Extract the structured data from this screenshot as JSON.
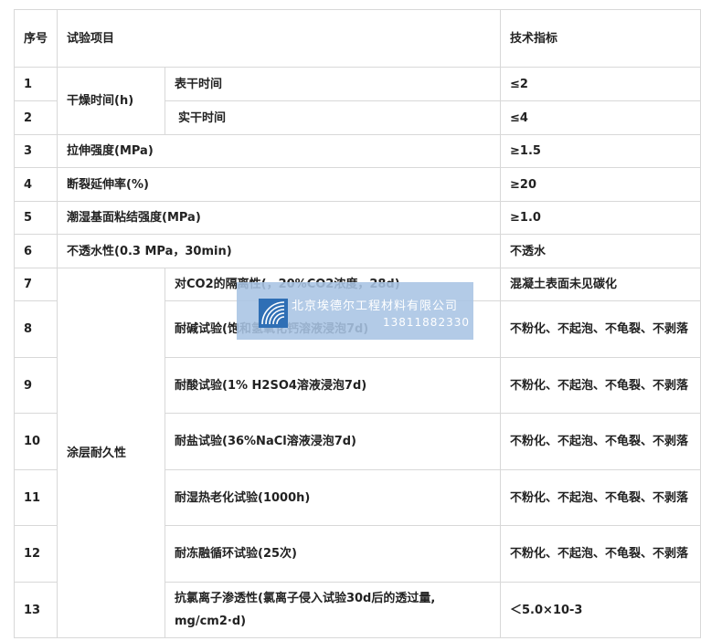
{
  "table": {
    "header": {
      "index": "序号",
      "item": "试验项目",
      "spec": "技术指标"
    },
    "rows": [
      {
        "index": "1",
        "category": "干燥时间(h)",
        "item": "表干时间",
        "spec": "≤2"
      },
      {
        "index": "2",
        "item": "实干时间",
        "spec": "≤4"
      },
      {
        "index": "3",
        "item": "拉伸强度(MPa)",
        "spec": "≥1.5"
      },
      {
        "index": "4",
        "item": "断裂延伸率(%)",
        "spec": "≥20"
      },
      {
        "index": "5",
        "item": "潮湿基面粘结强度(MPa)",
        "spec": "≥1.0"
      },
      {
        "index": "6",
        "item": "不透水性(0.3 MPa，30min)",
        "spec": "不透水"
      },
      {
        "index": "7",
        "category": "涂层耐久性",
        "item": "对CO2的隔离性(，20%CO2浓度，28d)",
        "spec": "混凝土表面未见碳化"
      },
      {
        "index": "8",
        "item": "耐碱试验(饱和氢氧化钙溶液浸泡7d)",
        "spec": "不粉化、不起泡、不龟裂、不剥落"
      },
      {
        "index": "9",
        "item": "耐酸试验(1% H2SO4溶液浸泡7d)",
        "spec": "不粉化、不起泡、不龟裂、不剥落"
      },
      {
        "index": "10",
        "item": "耐盐试验(36%NaCl溶液浸泡7d)",
        "spec": "不粉化、不起泡、不龟裂、不剥落"
      },
      {
        "index": "11",
        "item": "耐湿热老化试验(1000h)",
        "spec": "不粉化、不起泡、不龟裂、不剥落"
      },
      {
        "index": "12",
        "item": "耐冻融循环试验(25次)",
        "spec": "不粉化、不起泡、不龟裂、不剥落"
      },
      {
        "index": "13",
        "item": "抗氯离子渗透性(氯离子侵入试验30d后的透过量, mg/cm2·d)",
        "spec": "＜5.0×10-3"
      }
    ]
  },
  "watermark": {
    "company": "北京埃德尔工程材料有限公司",
    "phone": "13811882330",
    "logo_icon": "fan-stripes-logo-icon"
  },
  "colors": {
    "border": "#d8d8d8",
    "text": "#222222",
    "watermark_bg": "#a8c4e4",
    "logo": "#2f6fb5"
  }
}
